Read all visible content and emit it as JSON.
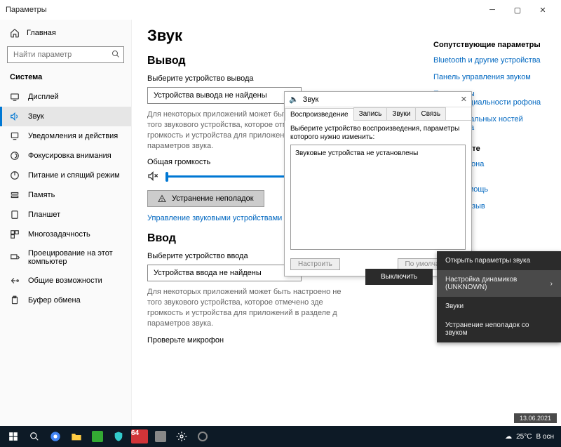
{
  "window": {
    "title": "Параметры"
  },
  "sidebar": {
    "home": "Главная",
    "search_placeholder": "Найти параметр",
    "group": "Система",
    "items": [
      {
        "label": "Дисплей"
      },
      {
        "label": "Звук"
      },
      {
        "label": "Уведомления и действия"
      },
      {
        "label": "Фокусировка внимания"
      },
      {
        "label": "Питание и спящий режим"
      },
      {
        "label": "Память"
      },
      {
        "label": "Планшет"
      },
      {
        "label": "Многозадачность"
      },
      {
        "label": "Проецирование на этот компьютер"
      },
      {
        "label": "Общие возможности"
      },
      {
        "label": "Буфер обмена"
      }
    ]
  },
  "page": {
    "title": "Звук",
    "output_h": "Вывод",
    "output_label": "Выберите устройство вывода",
    "output_combo": "Устройства вывода не найдены",
    "output_desc": "Для некоторых приложений может быть настроено не того звукового устройства, которое отмечено зде громкость и устройства для приложений в разделе д параметров звука.",
    "master_vol": "Общая громкость",
    "troubleshoot": "Устранение неполадок",
    "manage_link": "Управление звуковыми устройствами",
    "input_h": "Ввод",
    "input_label": "Выберите устройство ввода",
    "input_combo": "Устройства ввода не найдены",
    "input_desc": "Для некоторых приложений может быть настроено не того звукового устройства, которое отмечено зде громкость и устройства для приложений в разделе д параметров звука.",
    "mic_test": "Проверьте микрофон"
  },
  "rail": {
    "heading": "Сопутствующие параметры",
    "links": [
      "Bluetooth и другие устройства",
      "Панель управления звуком",
      "Параметры конфиденциальности рофона",
      "тры специальных ностей микрофона"
    ],
    "web_h": "в Интернете",
    "web_links": [
      "ка микрофона"
    ],
    "help": "лучить помощь",
    "feedback": "править отзыв"
  },
  "dialog": {
    "title": "Звук",
    "tabs": [
      "Воспроизведение",
      "Запись",
      "Звуки",
      "Связь"
    ],
    "hint": "Выберите устройство воспроизведения, параметры которого нужно изменить:",
    "empty": "Звуковые устройства не установлены",
    "btn_config": "Настроить",
    "btn_default": "По умолчанию"
  },
  "flyout": {
    "off": "Выключить"
  },
  "ctx": {
    "items": [
      "Открыть параметры звука",
      "Настройка динамиков (UNKNOWN)",
      "Звуки",
      "Устранение неполадок со звуком"
    ]
  },
  "taskbar": {
    "badge": "64",
    "temp": "25°C",
    "weather": "В осн",
    "date_float": "13.06.2021"
  }
}
